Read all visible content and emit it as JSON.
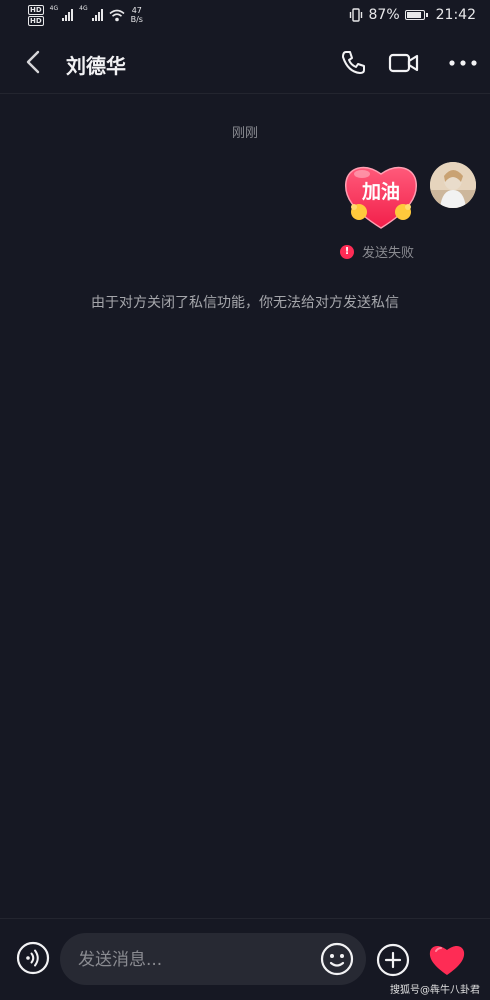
{
  "status_bar": {
    "network_1": "4G",
    "network_2": "4G",
    "speed_value": "47",
    "speed_unit": "B/s",
    "battery": "87%",
    "time": "21:42"
  },
  "header": {
    "title": "刘德华"
  },
  "chat": {
    "timestamp": "刚刚",
    "sticker_text": "加油",
    "fail_text": "发送失败",
    "notice": "由于对方关闭了私信功能，你无法给对方发送私信"
  },
  "input": {
    "placeholder": "发送消息..."
  },
  "watermark": "搜狐号@犇牛八卦君",
  "colors": {
    "background": "#161823",
    "accent": "#fe2c55"
  }
}
